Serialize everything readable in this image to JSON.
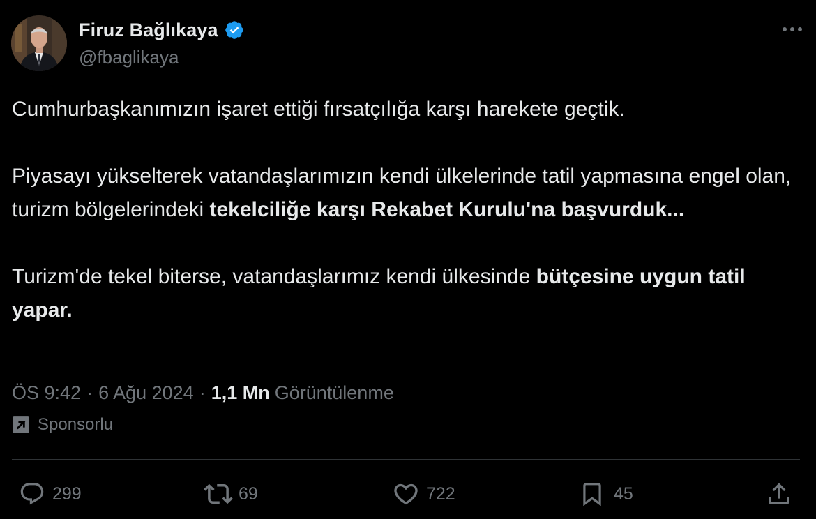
{
  "author": {
    "display_name": "Firuz Bağlıkaya",
    "handle": "@fbaglikaya",
    "verified_icon": "verified-badge-icon",
    "avatar": "profile-photo"
  },
  "tweet": {
    "p1": "Cumhurbaşkanımızın işaret ettiği fırsatçılığa karşı harekete geçtik.",
    "p2_normal": "Piyasayı yükselterek vatandaşlarımızın kendi ülkelerinde tatil yapmasına engel olan, turizm bölgelerindeki ",
    "p2_bold": "tekelciliğe karşı Rekabet Kurulu'na başvurduk...",
    "p3_normal": "Turizm'de tekel biterse, vatandaşlarımız kendi ülkesinde ",
    "p3_bold": "bütçesine uygun tatil yapar."
  },
  "meta": {
    "time": "ÖS 9:42",
    "separator": "·",
    "date": "6 Ağu 2024",
    "views_count": "1,1 Mn",
    "views_label": "Görüntülenme"
  },
  "sponsored": {
    "label": "Sponsorlu"
  },
  "actions": {
    "replies": "299",
    "reposts": "69",
    "likes": "722",
    "bookmarks": "45"
  },
  "colors": {
    "background": "#000000",
    "text": "#e7e9ea",
    "secondary": "#71767b",
    "verified": "#1d9bf0",
    "divider": "#2f3336"
  }
}
